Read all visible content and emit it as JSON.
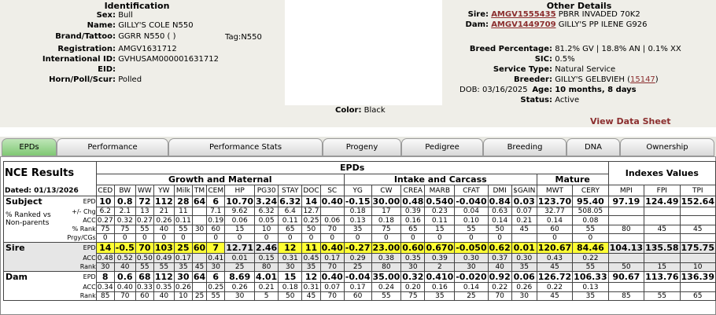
{
  "identification": {
    "title": "Identification",
    "sex_label": "Sex:",
    "sex": "Bull",
    "name_label": "Name:",
    "name": "GILLY'S COLE N550",
    "brand_label": "Brand/Tattoo:",
    "brand": "GGRR N550 ( )",
    "tag_label": "Tag:",
    "tag": "N550",
    "reg_label": "Registration:",
    "reg": "AMGV1631712",
    "intl_label": "International ID:",
    "intl": "GVHUSAM000001631712",
    "eid_label": "EID:",
    "eid": "",
    "horn_label": "Horn/Poll/Scur:",
    "horn": "Polled"
  },
  "color_label": "Color:",
  "color": "Black",
  "other": {
    "title": "Other Details",
    "sire_label": "Sire:",
    "sire_id": "AMGV1555435",
    "sire_name": "PBRR INVADED 70K2",
    "dam_label": "Dam:",
    "dam_id": "AMGV1449709",
    "dam_name": "GILLY'S PP ILENE G926",
    "breed_label": "Breed Percentage:",
    "breed": "81.2% GV | 18.8% AN | 0.1% XX",
    "sic_label": "SIC:",
    "sic": "0.5%",
    "service_label": "Service Type:",
    "service": "Natural Service",
    "breeder_label": "Breeder:",
    "breeder": "GILLY'S GELBVIEH (",
    "breeder_id": "15147",
    "breeder_close": ")",
    "dob_label": "DOB:",
    "dob": "03/16/2025",
    "age_label": "Age:",
    "age": "10 months, 8 days",
    "status_label": "Status:",
    "status": "Active",
    "view_sheet": "View Data Sheet"
  },
  "tabs": [
    "EPDs",
    "Performance",
    "Performance Stats",
    "Progeny",
    "Pedigree",
    "Breeding",
    "DNA",
    "Ownership"
  ],
  "epd": {
    "nce_title": "NCE Results",
    "dated": "Dated: 01/13/2026",
    "epds_header": "EPDs",
    "growth_header": "Growth and Maternal",
    "intake_header": "Intake and Carcass",
    "mature_header": "Mature",
    "indexes_header": "Indexes Values",
    "cols": [
      "CED",
      "BW",
      "WW",
      "YW",
      "Milk",
      "TM",
      "CEM",
      "HP",
      "PG30",
      "STAY",
      "DOC",
      "SC",
      "YG",
      "CW",
      "CREA",
      "MARB",
      "CFAT",
      "DMI",
      "$GAIN",
      "MWT",
      "CERY",
      "MPI",
      "FPI",
      "TPI"
    ],
    "subject": {
      "label": "Subject",
      "sub_labels": [
        "EPD",
        "+/- Chg",
        "ACC",
        "% Rank",
        "Prgy/CGs"
      ],
      "ranked_label": "% Ranked vs Non-parents",
      "epd": [
        "10",
        "0.8",
        "72",
        "112",
        "28",
        "64",
        "6",
        "10.70",
        "3.24",
        "6.32",
        "14",
        "0.40",
        "-0.15",
        "30.00",
        "0.48",
        "0.540",
        "-0.040",
        "0.84",
        "0.03",
        "123.70",
        "95.40",
        "97.19",
        "124.49",
        "152.64"
      ],
      "chg": [
        "6.2",
        "2.1",
        "13",
        "21",
        "11",
        "",
        "7.1",
        "9.62",
        "6.32",
        "6.4",
        "12.7",
        "",
        "0.18",
        "17",
        "0.39",
        "0.23",
        "0.04",
        "0.63",
        "0.07",
        "32.77",
        "508.05",
        "",
        "",
        ""
      ],
      "acc": [
        "0.27",
        "0.32",
        "0.27",
        "0.26",
        "0.11",
        "",
        "0.19",
        "0.06",
        "0.05",
        "0.11",
        "0.25",
        "0.06",
        "0.13",
        "0.18",
        "0.16",
        "0.11",
        "0.10",
        "0.14",
        "0.21",
        "0.14",
        "0.08",
        "",
        "",
        ""
      ],
      "rank": [
        "75",
        "75",
        "55",
        "40",
        "55",
        "30",
        "60",
        "15",
        "10",
        "65",
        "50",
        "70",
        "35",
        "75",
        "65",
        "15",
        "55",
        "50",
        "45",
        "60",
        "55",
        "80",
        "45",
        "45"
      ],
      "prgy": [
        "0",
        "0",
        "0",
        "0",
        "0",
        "",
        "0",
        "0",
        "0",
        "0",
        "0",
        "0",
        "0",
        "0",
        "0",
        "0",
        "0",
        "0",
        "",
        "0",
        "0",
        "",
        "",
        ""
      ]
    },
    "sire": {
      "label": "Sire",
      "sub_labels": [
        "EPD",
        "ACC",
        "Rank"
      ],
      "epd": [
        "14",
        "-0.5",
        "70",
        "103",
        "25",
        "60",
        "7",
        "12.71",
        "2.46",
        "12",
        "11",
        "0.40",
        "-0.27",
        "23.00",
        "0.60",
        "0.670",
        "-0.050",
        "0.62",
        "0.01",
        "120.67",
        "84.46",
        "104.13",
        "135.58",
        "175.75"
      ],
      "acc": [
        "0.48",
        "0.52",
        "0.50",
        "0.49",
        "0.17",
        "",
        "0.41",
        "0.01",
        "0.15",
        "0.31",
        "0.45",
        "0.17",
        "0.29",
        "0.38",
        "0.35",
        "0.39",
        "0.30",
        "0.37",
        "0.30",
        "0.43",
        "0.22",
        "",
        "",
        ""
      ],
      "rank": [
        "30",
        "40",
        "55",
        "55",
        "35",
        "45",
        "30",
        "25",
        "80",
        "30",
        "35",
        "70",
        "25",
        "80",
        "30",
        "2",
        "30",
        "40",
        "35",
        "45",
        "55",
        "50",
        "15",
        "10"
      ]
    },
    "dam": {
      "label": "Dam",
      "sub_labels": [
        "EPD",
        "ACC",
        "Rank"
      ],
      "epd": [
        "8",
        "0.6",
        "68",
        "112",
        "30",
        "64",
        "6",
        "8.69",
        "4.01",
        "15",
        "12",
        "0.40",
        "-0.04",
        "35.00",
        "0.32",
        "0.410",
        "-0.020",
        "0.92",
        "0.06",
        "126.72",
        "106.33",
        "90.67",
        "113.76",
        "136.39"
      ],
      "acc": [
        "0.34",
        "0.40",
        "0.33",
        "0.35",
        "0.26",
        "",
        "0.25",
        "0.26",
        "0.21",
        "0.18",
        "0.31",
        "0.07",
        "0.17",
        "0.24",
        "0.20",
        "0.16",
        "0.14",
        "0.22",
        "0.26",
        "0.22",
        "0.13",
        "",
        "",
        ""
      ],
      "rank": [
        "85",
        "70",
        "60",
        "40",
        "10",
        "25",
        "55",
        "30",
        "5",
        "50",
        "45",
        "70",
        "60",
        "55",
        "75",
        "35",
        "25",
        "70",
        "30",
        "45",
        "35",
        "85",
        "55",
        "65"
      ]
    },
    "sire_highlight": [
      1,
      1,
      1,
      1,
      1,
      1,
      1,
      0,
      0,
      1,
      1,
      1,
      1,
      1,
      1,
      1,
      1,
      1,
      1,
      1,
      1,
      0,
      0,
      0
    ],
    "colors": {
      "highlight": "#ffff33",
      "tab_active": "#7fc873",
      "link": "#8b2e2e"
    }
  }
}
